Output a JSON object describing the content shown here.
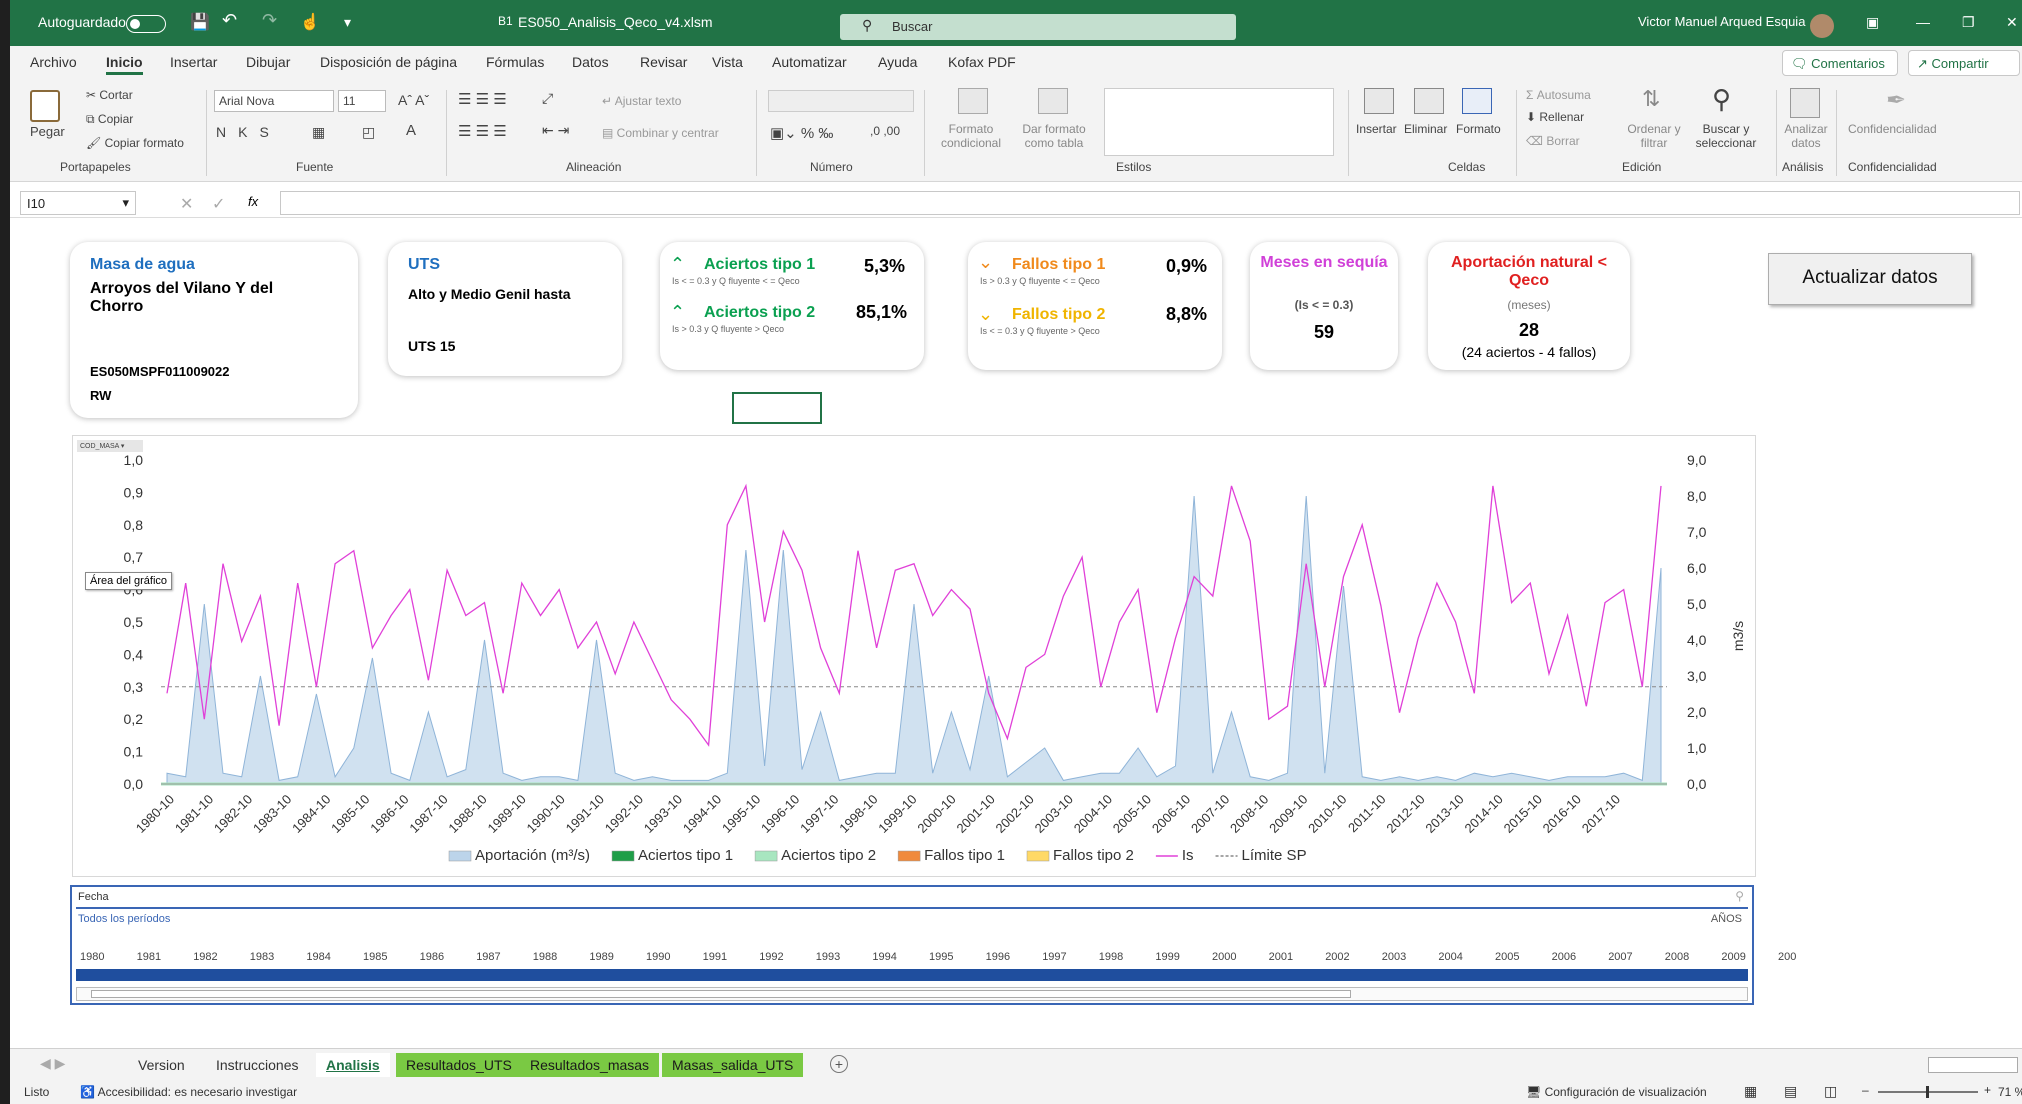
{
  "titlebar": {
    "autosave": "Autoguardado",
    "filename": "ES050_Analisis_Qeco_v4.xlsm",
    "search": "Buscar",
    "user": "Victor Manuel Arqued Esquia"
  },
  "menu": [
    "Archivo",
    "Inicio",
    "Insertar",
    "Dibujar",
    "Disposición de página",
    "Fórmulas",
    "Datos",
    "Revisar",
    "Vista",
    "Automatizar",
    "Ayuda",
    "Kofax PDF"
  ],
  "ribbon": {
    "paste": "Pegar",
    "cut": "Cortar",
    "copy": "Copiar",
    "copy_format": "Copiar formato",
    "font_name": "Arial Nova",
    "font_size": "11",
    "wrap": "Ajustar texto",
    "merge": "Combinar y centrar",
    "cond_format": "Formato condicional",
    "table_format": "Dar formato como tabla",
    "insert": "Insertar",
    "delete": "Eliminar",
    "format": "Formato",
    "autosum": "Autosuma",
    "fill": "Rellenar",
    "clear": "Borrar",
    "sort": "Ordenar y filtrar",
    "find": "Buscar y seleccionar",
    "analyze": "Analizar datos",
    "confidentiality": "Confidencialidad",
    "comments": "Comentarios",
    "share": "Compartir",
    "groups": [
      "Portapapeles",
      "Fuente",
      "Alineación",
      "Número",
      "Estilos",
      "Celdas",
      "Edición",
      "Análisis",
      "Confidencialidad"
    ]
  },
  "formula": {
    "namebox": "I10",
    "fx": "fx"
  },
  "cards": {
    "masa_title": "Masa de agua",
    "masa_name": "Arroyos del Vilano Y del Chorro",
    "masa_code": "ES050MSPF011009022",
    "masa_type": "RW",
    "uts_title": "UTS",
    "uts_name": "Alto y Medio Genil hasta",
    "uts_code": "UTS 15",
    "aciertos1_label": "Aciertos tipo 1",
    "aciertos1_sub": "Is < = 0.3 y Q fluyente < = Qeco",
    "aciertos1_value": "5,3%",
    "aciertos2_label": "Aciertos tipo 2",
    "aciertos2_sub": "Is > 0.3 y Q fluyente > Qeco",
    "aciertos2_value": "85,1%",
    "fallos1_label": "Fallos tipo 1",
    "fallos1_sub": "Is > 0.3 y Q fluyente < = Qeco",
    "fallos1_value": "0,9%",
    "fallos2_label": "Fallos tipo 2",
    "fallos2_sub": "Is < = 0.3 y Q fluyente > Qeco",
    "fallos2_value": "8,8%",
    "sequia_title": "Meses en sequía",
    "sequia_sub": "(Is < = 0.3)",
    "sequia_value": "59",
    "aport_title": "Aportación natural < Qeco",
    "aport_sub": "(meses)",
    "aport_value": "28",
    "aport_detail": "(24 aciertos - 4 fallos)",
    "update_button": "Actualizar datos"
  },
  "colors": {
    "excel_green": "#217346",
    "aportacion": "#bcd4ea",
    "is_line": "#e040d8",
    "aciertos1": "#1f9e48",
    "aciertos2": "#a8e6c0",
    "fallos1": "#f08a3c",
    "fallos2": "#ffd966",
    "masa_title": "#1f6fbf",
    "aciertos": "#0aa050",
    "fallos": "#f08a1c",
    "sequia": "#d040d8",
    "aport": "#e02020"
  },
  "chart_data": {
    "type": "line",
    "title": "",
    "field_button": "COD_MASA",
    "tooltip": "Área del gráfico",
    "x_ticks": [
      "1980-10",
      "1981-10",
      "1982-10",
      "1983-10",
      "1984-10",
      "1985-10",
      "1986-10",
      "1987-10",
      "1988-10",
      "1989-10",
      "1990-10",
      "1991-10",
      "1992-10",
      "1993-10",
      "1994-10",
      "1995-10",
      "1996-10",
      "1997-10",
      "1998-10",
      "1999-10",
      "2000-10",
      "2001-10",
      "2002-10",
      "2003-10",
      "2004-10",
      "2005-10",
      "2006-10",
      "2007-10",
      "2008-10",
      "2009-10",
      "2010-10",
      "2011-10",
      "2012-10",
      "2013-10",
      "2014-10",
      "2015-10",
      "2016-10",
      "2017-10"
    ],
    "ylim_left": [
      0,
      1
    ],
    "ylim_right": [
      0,
      9
    ],
    "y_left_ticks": [
      "0,0",
      "0,1",
      "0,2",
      "0,3",
      "0,4",
      "0,5",
      "0,6",
      "0,7",
      "0,8",
      "0,9",
      "1,0"
    ],
    "y_right_ticks": [
      "0,0",
      "1,0",
      "2,0",
      "3,0",
      "4,0",
      "5,0",
      "6,0",
      "7,0",
      "8,0",
      "9,0"
    ],
    "y_right_label": "m3/s",
    "threshold": 0.3,
    "legend": [
      "Aportación (m³/s)",
      "Aciertos tipo 1",
      "Aciertos tipo 2",
      "Fallos tipo 1",
      "Fallos tipo 2",
      "Is",
      "Límite SP"
    ],
    "series": [
      {
        "name": "Is",
        "values": [
          0.28,
          0.62,
          0.2,
          0.68,
          0.44,
          0.58,
          0.18,
          0.62,
          0.3,
          0.68,
          0.72,
          0.42,
          0.52,
          0.6,
          0.32,
          0.66,
          0.52,
          0.56,
          0.28,
          0.62,
          0.52,
          0.6,
          0.42,
          0.5,
          0.34,
          0.5,
          0.38,
          0.26,
          0.2,
          0.12,
          0.8,
          0.92,
          0.5,
          0.78,
          0.66,
          0.42,
          0.28,
          0.72,
          0.42,
          0.66,
          0.68,
          0.52,
          0.6,
          0.54,
          0.28,
          0.14,
          0.36,
          0.4,
          0.58,
          0.7,
          0.3,
          0.5,
          0.6,
          0.22,
          0.45,
          0.64,
          0.58,
          0.92,
          0.75,
          0.2,
          0.24,
          0.68,
          0.3,
          0.64,
          0.8,
          0.55,
          0.22,
          0.45,
          0.62,
          0.5,
          0.28,
          0.92,
          0.56,
          0.62,
          0.34,
          0.52,
          0.24,
          0.56,
          0.6,
          0.3,
          0.92
        ]
      },
      {
        "name": "Aportación (m³/s)",
        "values": [
          0.3,
          0.2,
          5.0,
          0.3,
          0.2,
          3.0,
          0.1,
          0.2,
          2.5,
          0.2,
          1.0,
          3.5,
          0.3,
          0.1,
          2.0,
          0.2,
          0.4,
          4.0,
          0.3,
          0.1,
          0.2,
          0.2,
          0.1,
          4.0,
          0.3,
          0.1,
          0.2,
          0.1,
          0.1,
          0.1,
          0.3,
          6.5,
          0.5,
          6.5,
          0.4,
          2.0,
          0.1,
          0.2,
          0.3,
          0.3,
          5.0,
          0.3,
          2.0,
          0.4,
          3.0,
          0.2,
          0.6,
          1.0,
          0.1,
          0.2,
          0.3,
          0.3,
          1.0,
          0.2,
          0.5,
          8.0,
          0.3,
          2.0,
          0.2,
          0.1,
          0.3,
          8.0,
          0.3,
          5.5,
          0.2,
          0.1,
          0.2,
          0.1,
          0.2,
          0.1,
          0.3,
          0.2,
          0.3,
          0.2,
          0.1,
          0.2,
          0.2,
          0.2,
          0.3,
          0.1,
          6.0
        ]
      }
    ]
  },
  "slicer": {
    "title": "Fecha",
    "subtitle": "Todos los períodos",
    "level": "AÑOS",
    "years": [
      "1980",
      "1981",
      "1982",
      "1983",
      "1984",
      "1985",
      "1986",
      "1987",
      "1988",
      "1989",
      "1990",
      "1991",
      "1992",
      "1993",
      "1994",
      "1995",
      "1996",
      "1997",
      "1998",
      "1999",
      "2000",
      "2001",
      "2002",
      "2003",
      "2004",
      "2005",
      "2006",
      "2007",
      "2008",
      "2009",
      "200"
    ]
  },
  "sheet_tabs": [
    "Version",
    "Instrucciones",
    "Analisis",
    "Resultados_UTS",
    "Resultados_masas",
    "Masas_salida_UTS"
  ],
  "statusbar": {
    "ready": "Listo",
    "accessibility": "Accesibilidad: es necesario investigar",
    "display": "Configuración de visualización",
    "zoom": "71 %"
  }
}
